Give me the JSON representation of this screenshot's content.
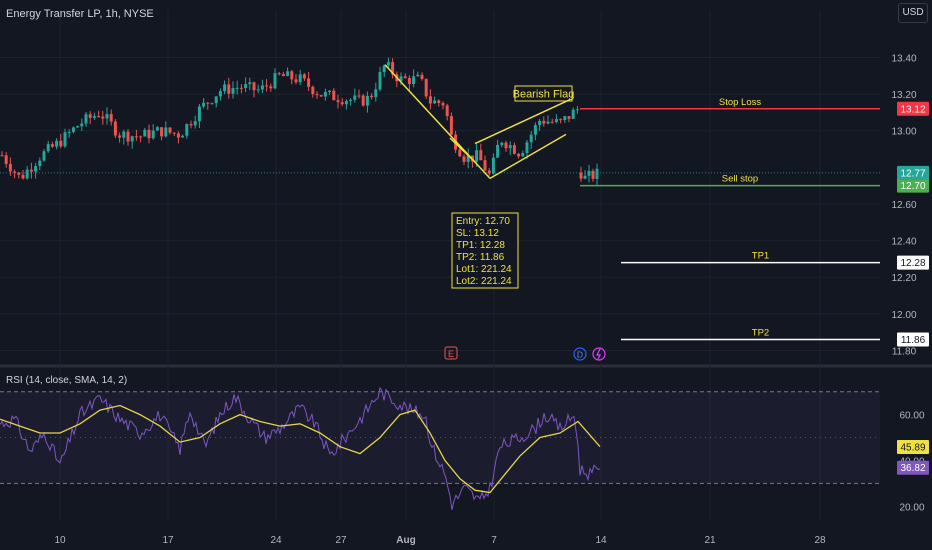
{
  "header": {
    "title": "Energy Transfer LP, 1h, NYSE",
    "currency": "USD"
  },
  "colors": {
    "bg": "#131722",
    "up": "#26a69a",
    "down": "#ef5350",
    "grid": "#1e222d",
    "yellow": "#f0e040",
    "stop": "#f23645",
    "sell": "#4caf50",
    "white": "#ffffff",
    "rsi": "#7e57c2",
    "rsi_ma": "#e6d34c",
    "axis_text": "#b2b5be"
  },
  "chart_data": {
    "type": "candlestick",
    "x_ticks": [
      "10",
      "17",
      "24",
      "27",
      "Aug",
      "7",
      "14",
      "21",
      "28"
    ],
    "y_ticks": [
      11.8,
      12.0,
      12.2,
      12.4,
      12.6,
      13.0,
      13.2,
      13.4
    ],
    "ylim": [
      11.77,
      13.55
    ],
    "waypoints": [
      [
        0,
        12.88
      ],
      [
        20,
        12.74
      ],
      [
        40,
        12.86
      ],
      [
        60,
        12.94
      ],
      [
        80,
        13.04
      ],
      [
        100,
        13.1
      ],
      [
        120,
        12.98
      ],
      [
        140,
        12.97
      ],
      [
        160,
        13.0
      ],
      [
        180,
        12.98
      ],
      [
        200,
        13.12
      ],
      [
        220,
        13.22
      ],
      [
        240,
        13.24
      ],
      [
        260,
        13.22
      ],
      [
        280,
        13.3
      ],
      [
        300,
        13.28
      ],
      [
        320,
        13.2
      ],
      [
        340,
        13.18
      ],
      [
        360,
        13.16
      ],
      [
        370,
        13.18
      ],
      [
        385,
        13.36
      ],
      [
        400,
        13.28
      ],
      [
        420,
        13.28
      ],
      [
        430,
        13.16
      ],
      [
        445,
        13.15
      ],
      [
        450,
        12.98
      ],
      [
        465,
        12.85
      ],
      [
        478,
        12.86
      ],
      [
        490,
        12.75
      ],
      [
        500,
        12.96
      ],
      [
        520,
        12.88
      ],
      [
        540,
        13.06
      ],
      [
        560,
        13.04
      ],
      [
        578,
        13.12
      ]
    ],
    "waypoints_b": [
      [
        580,
        12.78
      ],
      [
        585,
        12.74
      ],
      [
        600,
        12.77
      ]
    ],
    "labels": {
      "pattern": "Bearish Flag",
      "stop_loss": "Stop Loss",
      "sell_stop": "Sell stop",
      "tp1": "TP1",
      "tp2": "TP2"
    },
    "levels": [
      {
        "name": "Stop Loss",
        "price": 13.12,
        "tag": "13.12"
      },
      {
        "name": "Sell stop",
        "price": 12.7,
        "tag": "12.70"
      },
      {
        "name": "TP1",
        "price": 12.28,
        "tag": "12.28"
      },
      {
        "name": "TP2",
        "price": 11.86,
        "tag": "11.86"
      }
    ],
    "last_price": {
      "price": 12.77,
      "tag": "12.77"
    },
    "info_box": [
      "Entry: 12.70",
      "SL: 13.12",
      "TP1: 12.28",
      "TP2: 11.86",
      "Lot1: 221.24",
      "Lot2: 221.24"
    ],
    "markers": [
      "E",
      "D"
    ],
    "rsi": {
      "title": "RSI (14, close, SMA, 14, 2)",
      "y_ticks": [
        20.0,
        40.0,
        60.0
      ],
      "ylim": [
        14,
        76
      ],
      "bands": [
        70,
        30
      ],
      "value": "45.89",
      "rsi_value": "36.82",
      "rsi_waypoints": [
        [
          0,
          56
        ],
        [
          15,
          58
        ],
        [
          30,
          44
        ],
        [
          45,
          52
        ],
        [
          60,
          38
        ],
        [
          80,
          60
        ],
        [
          100,
          67
        ],
        [
          120,
          58
        ],
        [
          140,
          52
        ],
        [
          160,
          60
        ],
        [
          180,
          45
        ],
        [
          190,
          62
        ],
        [
          205,
          46
        ],
        [
          220,
          60
        ],
        [
          235,
          68
        ],
        [
          250,
          58
        ],
        [
          265,
          50
        ],
        [
          280,
          54
        ],
        [
          300,
          63
        ],
        [
          315,
          56
        ],
        [
          330,
          42
        ],
        [
          345,
          50
        ],
        [
          360,
          58
        ],
        [
          380,
          70
        ],
        [
          395,
          66
        ],
        [
          410,
          62
        ],
        [
          425,
          60
        ],
        [
          432,
          46
        ],
        [
          445,
          34
        ],
        [
          452,
          21
        ],
        [
          465,
          28
        ],
        [
          480,
          22
        ],
        [
          490,
          28
        ],
        [
          500,
          46
        ],
        [
          520,
          50
        ],
        [
          535,
          54
        ],
        [
          545,
          60
        ],
        [
          560,
          54
        ],
        [
          575,
          60
        ],
        [
          580,
          36
        ],
        [
          592,
          34
        ],
        [
          600,
          38
        ]
      ],
      "ma_waypoints": [
        [
          0,
          58
        ],
        [
          20,
          55
        ],
        [
          40,
          52
        ],
        [
          60,
          52
        ],
        [
          80,
          56
        ],
        [
          100,
          62
        ],
        [
          120,
          64
        ],
        [
          140,
          60
        ],
        [
          160,
          55
        ],
        [
          180,
          48
        ],
        [
          200,
          50
        ],
        [
          220,
          56
        ],
        [
          240,
          60
        ],
        [
          260,
          57
        ],
        [
          280,
          55
        ],
        [
          300,
          56
        ],
        [
          320,
          52
        ],
        [
          340,
          46
        ],
        [
          360,
          43
        ],
        [
          380,
          50
        ],
        [
          400,
          60
        ],
        [
          415,
          62
        ],
        [
          430,
          52
        ],
        [
          445,
          40
        ],
        [
          460,
          32
        ],
        [
          475,
          27
        ],
        [
          490,
          26
        ],
        [
          505,
          34
        ],
        [
          520,
          42
        ],
        [
          540,
          50
        ],
        [
          560,
          52
        ],
        [
          578,
          57
        ],
        [
          600,
          46
        ]
      ]
    }
  }
}
